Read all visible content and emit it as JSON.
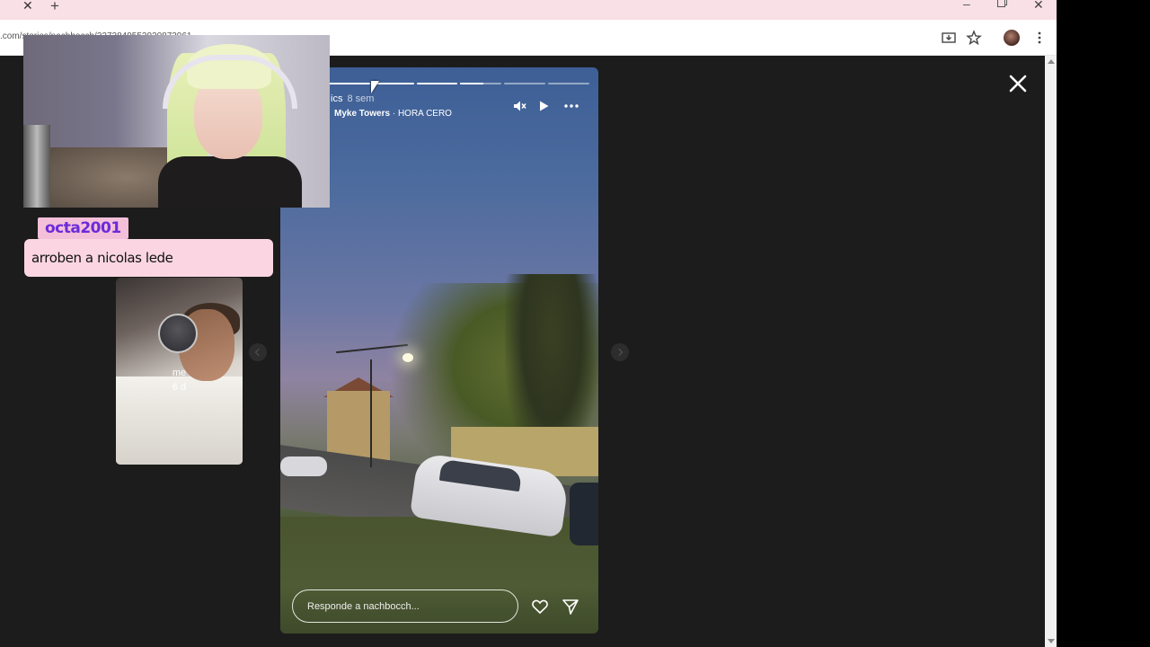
{
  "browser": {
    "url_text": ".com/stories/nachbocch/3273849553920873961",
    "window_controls": {
      "minimize": "–",
      "close": "✕"
    },
    "tab_close": "✕",
    "new_tab": "+"
  },
  "story": {
    "username_partial": "ics",
    "time": "8 sem",
    "music_artist": "Myke Towers",
    "music_sep": " · ",
    "music_track": "HORA CERO",
    "progress_segments": [
      1,
      1,
      1,
      0.55,
      0,
      0
    ],
    "reply_placeholder": "Responde a nachbocch...",
    "controls": [
      "mute-icon",
      "play-icon",
      "more-icon"
    ]
  },
  "preview": {
    "name": "me",
    "time": "6 d"
  },
  "chat": {
    "username": "octa2001",
    "message": "arroben a nicolas lede"
  },
  "colors": {
    "page_bg": "#1c1c1c",
    "tabbar_bg": "#f9dfe6",
    "chat_name_bg": "#f4bfd9",
    "chat_name_fg": "#6b2bd8",
    "chat_msg_bg": "#fbd6e2"
  }
}
